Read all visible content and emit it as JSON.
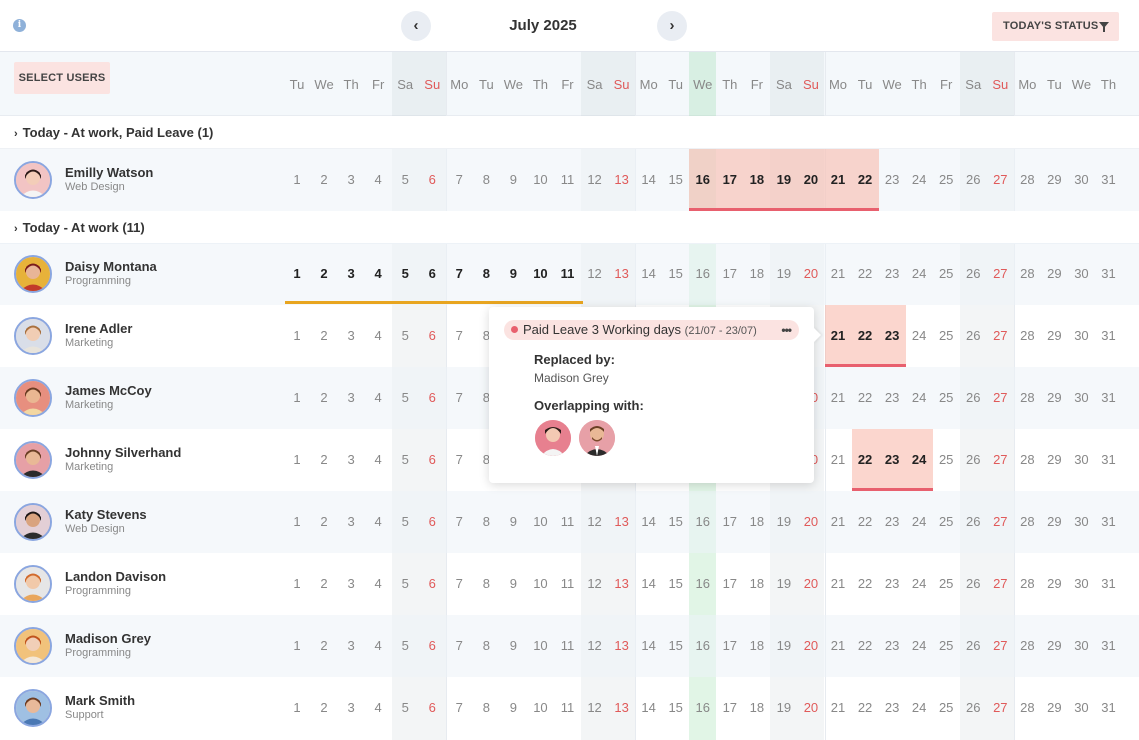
{
  "topbar": {
    "month": "July 2025",
    "prev_icon": "chevron-left-icon",
    "next_icon": "chevron-right-icon",
    "prev_glyph": "‹",
    "next_glyph": "›",
    "info_glyph": "i",
    "status_label": "TODAY'S STATUS"
  },
  "select_users_label": "SELECT USERS",
  "weekdays": [
    "Tu",
    "We",
    "Th",
    "Fr",
    "Sa",
    "Su",
    "Mo",
    "Tu",
    "We",
    "Th",
    "Fr",
    "Sa",
    "Su",
    "Mo",
    "Tu",
    "We",
    "Th",
    "Fr",
    "Sa",
    "Su",
    "Mo",
    "Tu",
    "We",
    "Th",
    "Fr",
    "Sa",
    "Su",
    "Mo",
    "Tu",
    "We",
    "Th"
  ],
  "groups": [
    {
      "label": "Today - At work, Paid Leave (1)",
      "chevron": "›"
    },
    {
      "label": "Today - At work (11)",
      "chevron": "›"
    }
  ],
  "users": [
    {
      "name": "Emilly Watson",
      "dept": "Web Design",
      "leave": [
        16,
        22
      ],
      "bold": [
        16,
        17,
        18,
        19,
        20,
        21,
        22
      ]
    },
    {
      "name": "Daisy Montana",
      "dept": "Programming",
      "work": [
        1,
        11
      ],
      "bold": [
        1,
        2,
        3,
        4,
        5,
        6,
        7,
        8,
        9,
        10,
        11
      ]
    },
    {
      "name": "Irene Adler",
      "dept": "Marketing",
      "leave": [
        21,
        23
      ],
      "bold": [
        21,
        22,
        23
      ]
    },
    {
      "name": "James McCoy",
      "dept": "Marketing"
    },
    {
      "name": "Johnny Silverhand",
      "dept": "Marketing",
      "leave": [
        22,
        24
      ],
      "bold": [
        22,
        23,
        24
      ]
    },
    {
      "name": "Katy Stevens",
      "dept": "Web Design"
    },
    {
      "name": "Landon Davison",
      "dept": "Programming"
    },
    {
      "name": "Madison Grey",
      "dept": "Programming"
    },
    {
      "name": "Mark Smith",
      "dept": "Support"
    }
  ],
  "popover": {
    "type": "Paid Leave",
    "duration": "3 Working days",
    "dates": "(21/07 - 23/07)",
    "more": "•••",
    "replaced_heading": "Replaced by:",
    "replaced_name": "Madison Grey",
    "overlap_heading": "Overlapping with:"
  },
  "colors": {
    "leave": "#e8606e",
    "work_bar": "#e8a520",
    "today": "#d9f2df",
    "accent_button": "#fbe3e1",
    "sunday": "#e05a5a"
  },
  "today_day": 16
}
